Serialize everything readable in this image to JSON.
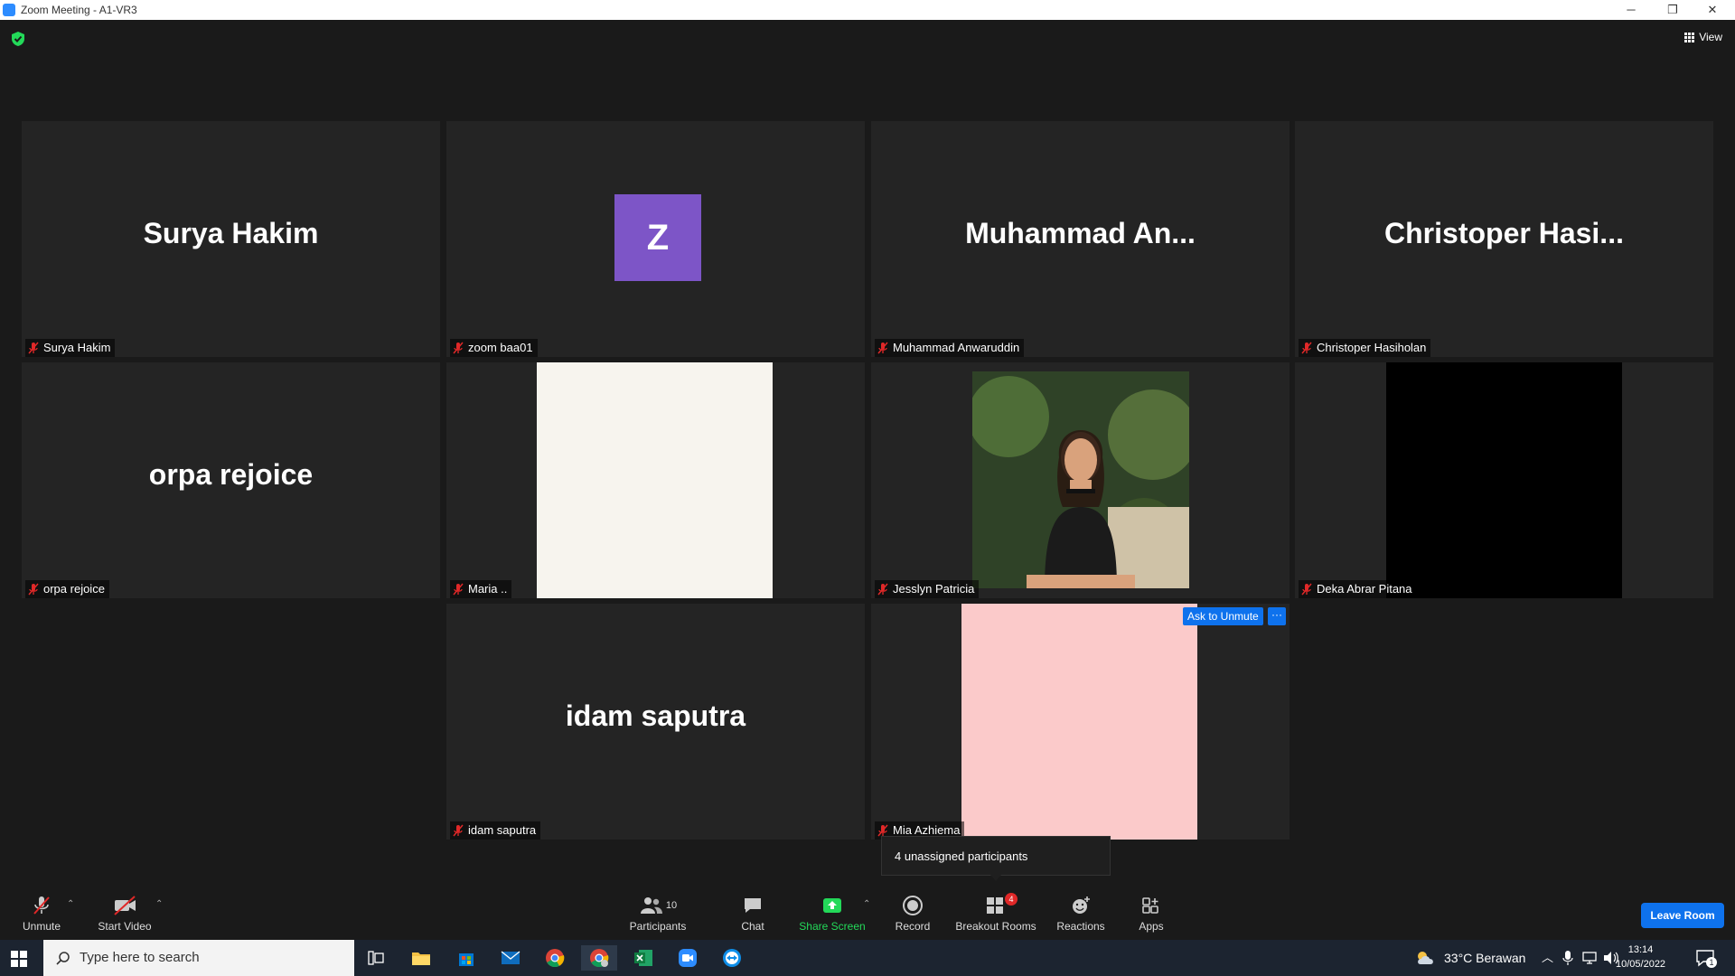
{
  "window": {
    "title": "Zoom Meeting - A1-VR3",
    "minimize": "─",
    "restore": "❐",
    "close": "✕"
  },
  "topbar": {
    "view_label": "View"
  },
  "tiles": [
    {
      "display_name": "Surya Hakim",
      "label": "Surya Hakim"
    },
    {
      "avatar_letter": "Z",
      "label": "zoom baa01"
    },
    {
      "display_name": "Muhammad  An...",
      "label": "Muhammad Anwaruddin"
    },
    {
      "display_name": "Christoper  Hasi...",
      "label": "Christoper Hasiholan"
    },
    {
      "display_name": "orpa rejoice",
      "label": "orpa rejoice"
    },
    {
      "label": "Maria .."
    },
    {
      "label": "Jesslyn Patricia"
    },
    {
      "label": "Deka Abrar Pitana"
    },
    {
      "display_name": "idam saputra",
      "label": "idam saputra"
    },
    {
      "label": "Mia Azhiema"
    }
  ],
  "ask_to_unmute": "Ask to Unmute",
  "more_button": "···",
  "breakout_popup": "4 unassigned participants",
  "toolbar": {
    "unmute": "Unmute",
    "start_video": "Start Video",
    "participants": "Participants",
    "participants_count": "10",
    "chat": "Chat",
    "share_screen": "Share Screen",
    "record": "Record",
    "breakout_rooms": "Breakout Rooms",
    "breakout_badge": "4",
    "reactions": "Reactions",
    "apps": "Apps",
    "leave_room": "Leave Room"
  },
  "taskbar": {
    "search_placeholder": "Type here to search",
    "weather": "33°C  Berawan",
    "time": "13:14",
    "date": "10/05/2022",
    "notification_count": "1"
  },
  "colors": {
    "accent": "#0e72ed",
    "share_green": "#23d959",
    "mic_off_red": "#e02828",
    "avatar_purple": "#7d55c7"
  }
}
